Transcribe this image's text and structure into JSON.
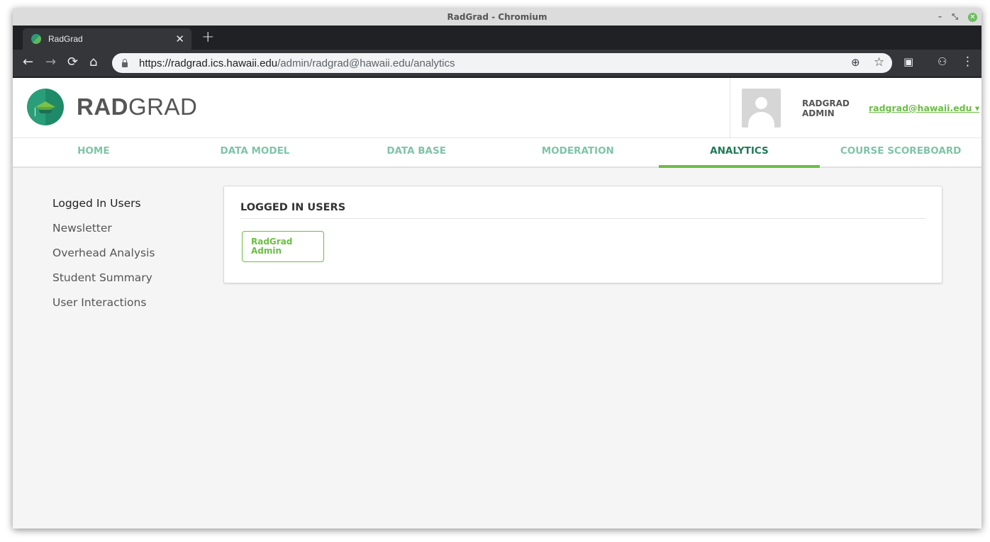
{
  "window": {
    "title": "RadGrad - Chromium",
    "minimize": "–",
    "restore": "⤡",
    "close": "✕"
  },
  "tab": {
    "title": "RadGrad",
    "close": "✕",
    "new_tab": "+"
  },
  "toolbar": {
    "url_host": "https://radgrad.ics.hawaii.edu",
    "url_path": "/admin/radgrad@hawaii.edu/analytics",
    "back": "←",
    "forward": "→",
    "reload": "⟳",
    "home": "⌂",
    "zoom": "⊕",
    "star": "☆",
    "extension": "▣",
    "incognito": "⚇",
    "menu": "⋮"
  },
  "brand": {
    "bold": "RAD",
    "light": "GRAD"
  },
  "user": {
    "role": "RADGRAD ADMIN",
    "email": "radgrad@hawaii.edu ▾"
  },
  "menu": {
    "items": [
      {
        "label": "HOME"
      },
      {
        "label": "DATA MODEL"
      },
      {
        "label": "DATA BASE"
      },
      {
        "label": "MODERATION"
      },
      {
        "label": "ANALYTICS"
      },
      {
        "label": "COURSE SCOREBOARD"
      }
    ],
    "active": "ANALYTICS"
  },
  "sidebar": {
    "items": [
      {
        "label": "Logged In Users"
      },
      {
        "label": "Newsletter"
      },
      {
        "label": "Overhead Analysis"
      },
      {
        "label": "Student Summary"
      },
      {
        "label": "User Interactions"
      }
    ]
  },
  "panel": {
    "title": "LOGGED IN USERS",
    "users": [
      {
        "name": "RadGrad Admin"
      }
    ]
  },
  "colors": {
    "accent": "#6cbd45",
    "menu_inactive": "#7fc4a8",
    "menu_active": "#1e7a58"
  }
}
